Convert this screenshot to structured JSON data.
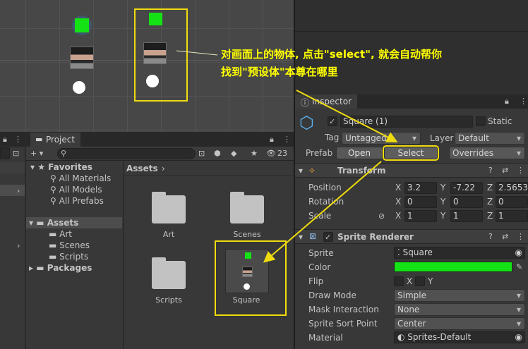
{
  "annotation": {
    "line1": "对画面上的物体, 点击\"select\", 就会自动帮你",
    "line2": "找到\"预设体\"本尊在哪里"
  },
  "project": {
    "tab": "Project",
    "count": "23",
    "search_placeholder": "",
    "favorites": {
      "title": "Favorites",
      "items": [
        "All Materials",
        "All Models",
        "All Prefabs"
      ]
    },
    "assets": {
      "title": "Assets",
      "items": [
        "Art",
        "Scenes",
        "Scripts"
      ]
    },
    "packages": "Packages",
    "breadcrumb": "Assets",
    "grid_items": [
      "Art",
      "Scenes",
      "Scripts",
      "Square"
    ]
  },
  "inspector": {
    "tab": "Inspector",
    "object_name": "Square (1)",
    "static_label": "Static",
    "tag_label": "Tag",
    "tag_value": "Untagged",
    "layer_label": "Layer",
    "layer_value": "Default",
    "prefab_label": "Prefab",
    "open_btn": "Open",
    "select_btn": "Select",
    "overrides_btn": "Overrides",
    "transform": {
      "title": "Transform",
      "position_label": "Position",
      "rotation_label": "Rotation",
      "scale_label": "Scale",
      "position": {
        "x": "3.2",
        "y": "-7.22",
        "z": "2.5653"
      },
      "rotation": {
        "x": "0",
        "y": "0",
        "z": "0"
      },
      "scale": {
        "x": "1",
        "y": "1",
        "z": "1"
      }
    },
    "sprite_renderer": {
      "title": "Sprite Renderer",
      "sprite_label": "Sprite",
      "sprite_value": "Square",
      "color_label": "Color",
      "color_value": "#14e214",
      "flip_label": "Flip",
      "flip_x": "X",
      "flip_y": "Y",
      "draw_mode_label": "Draw Mode",
      "draw_mode": "Simple",
      "mask_label": "Mask Interaction",
      "mask_value": "None",
      "sort_label": "Sprite Sort Point",
      "sort_value": "Center",
      "material_label": "Material",
      "material_value": "Sprites-Default"
    },
    "axes": {
      "x": "X",
      "y": "Y",
      "z": "Z"
    }
  },
  "colors": {
    "accent": "#f0dc0e",
    "selected_green": "#14e214"
  }
}
